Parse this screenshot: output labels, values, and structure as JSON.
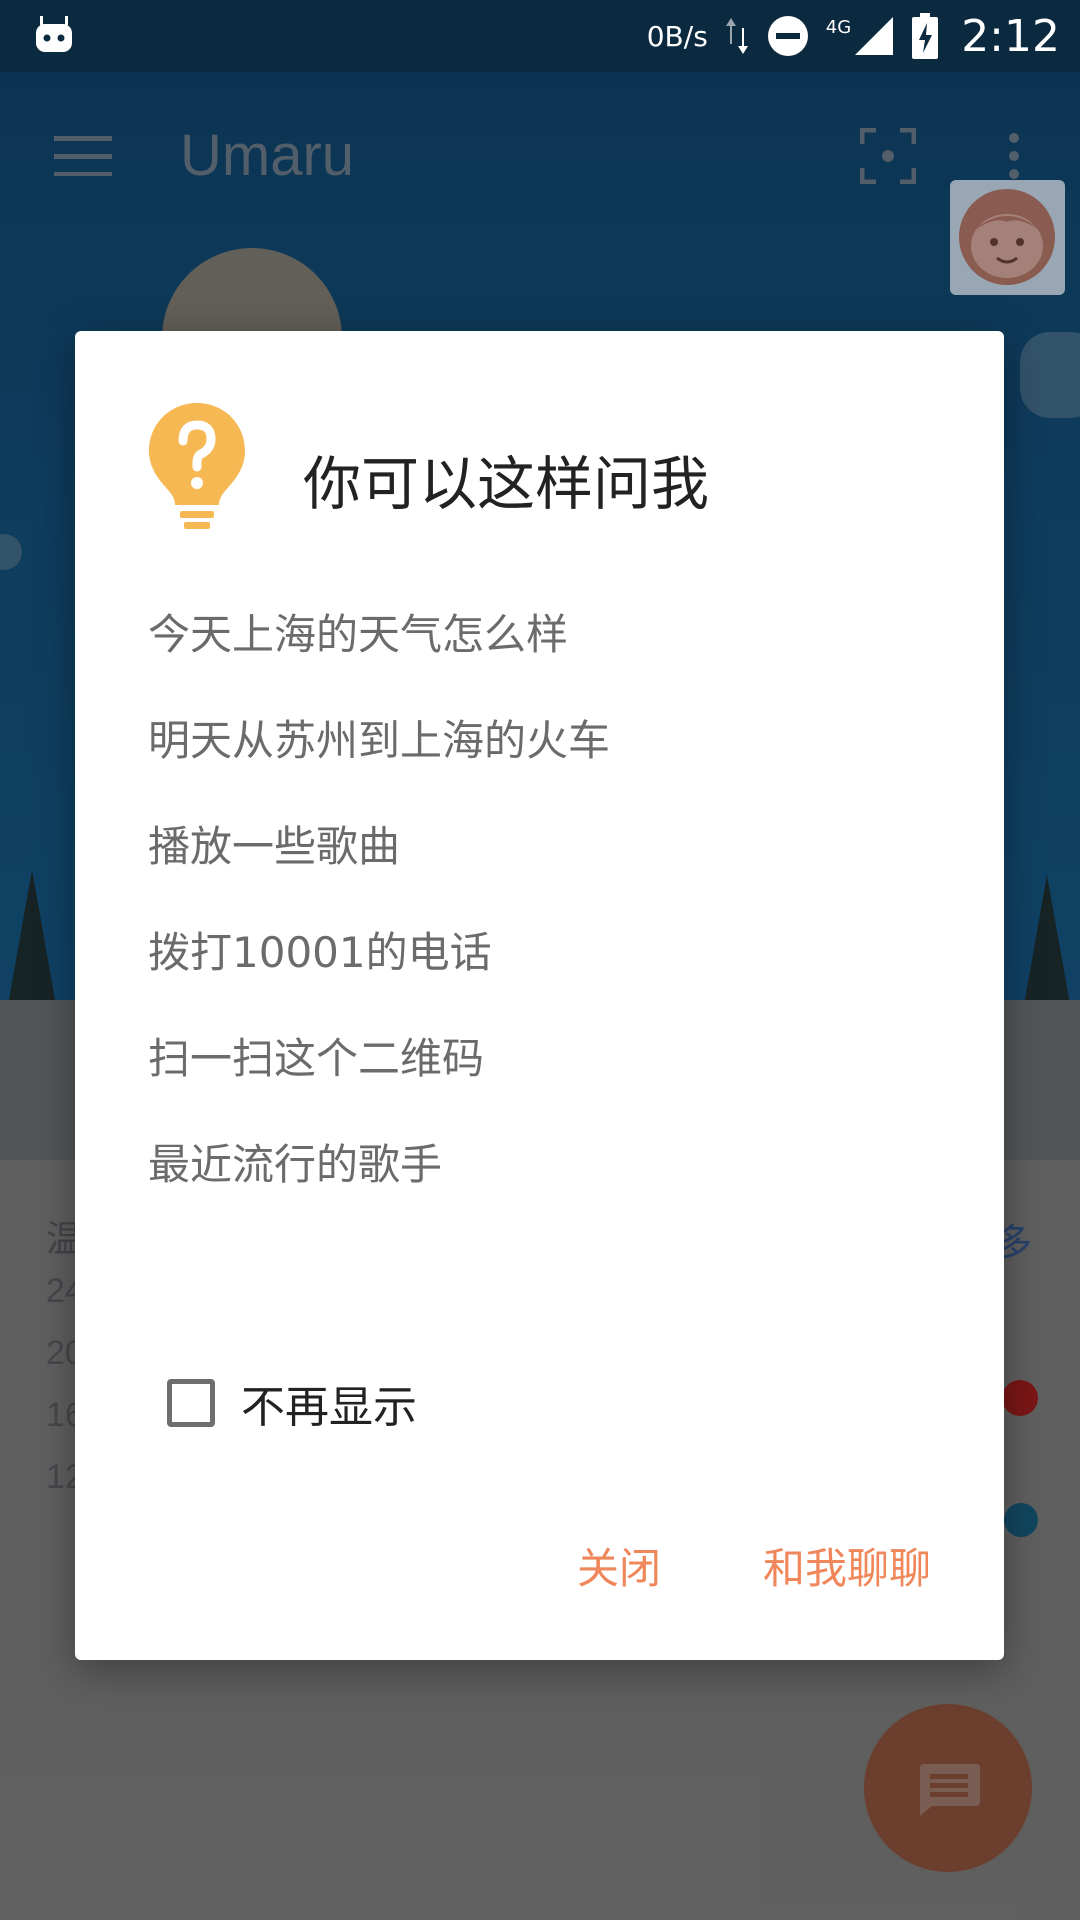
{
  "status_bar": {
    "net_speed": "0B/s",
    "network": "4G",
    "time": "2:12"
  },
  "app_bar": {
    "title": "Umaru"
  },
  "background_list": {
    "header": "温",
    "more": "多",
    "items": [
      "24",
      "20",
      "16",
      "12"
    ]
  },
  "dialog": {
    "title": "你可以这样问我",
    "suggestions": [
      "今天上海的天气怎么样",
      "明天从苏州到上海的火车",
      "播放一些歌曲",
      "拨打10001的电话",
      "扫一扫这个二维码",
      "最近流行的歌手"
    ],
    "dont_show_label": "不再显示",
    "dont_show_checked": false,
    "close_button": "关闭",
    "chat_button": "和我聊聊"
  },
  "colors": {
    "accent": "#f0875a",
    "icon_bulb": "#f5b853",
    "status_bar_bg": "#0b2a40"
  }
}
